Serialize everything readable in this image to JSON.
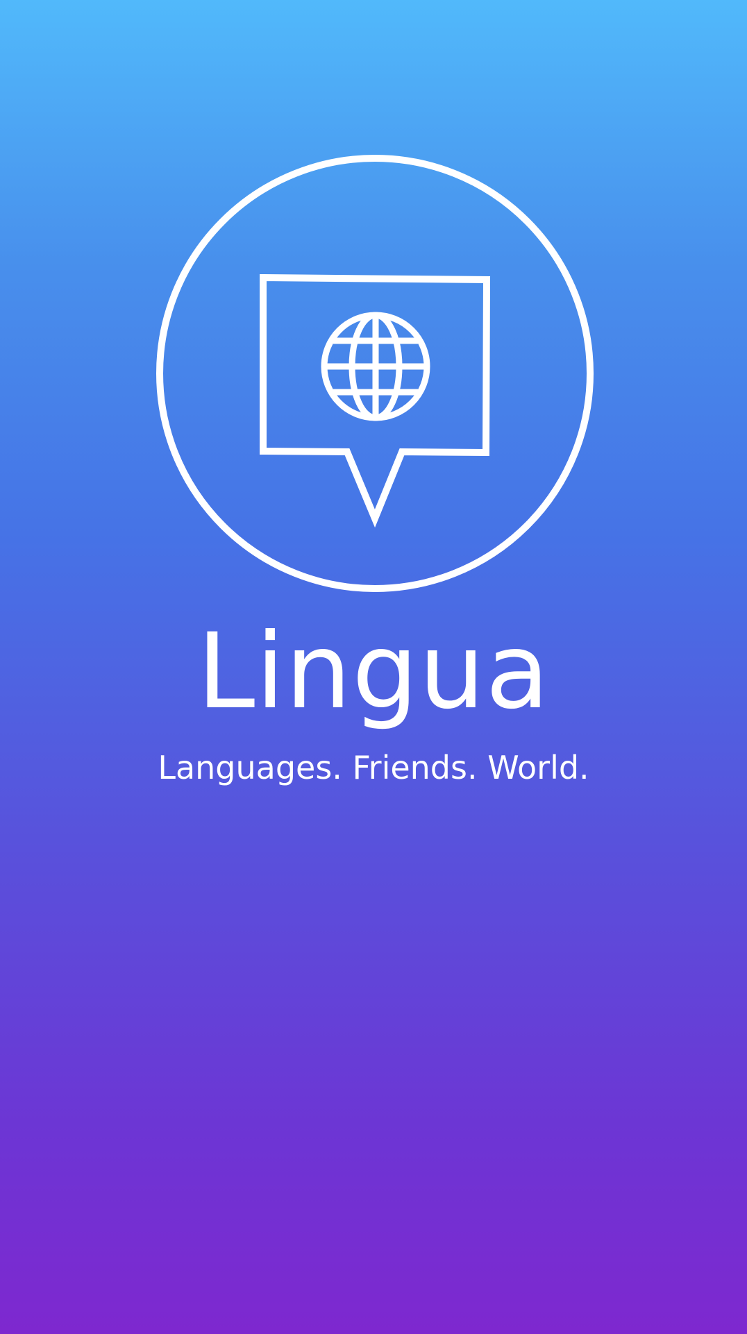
{
  "app": {
    "name": "Lingua",
    "tagline": "Languages. Friends. World."
  },
  "icons": {
    "logo": "speech-bubble-globe-icon"
  },
  "colors": {
    "gradient_top": "#51b9fb",
    "gradient_bottom": "#7e28cf",
    "foreground": "#ffffff"
  }
}
